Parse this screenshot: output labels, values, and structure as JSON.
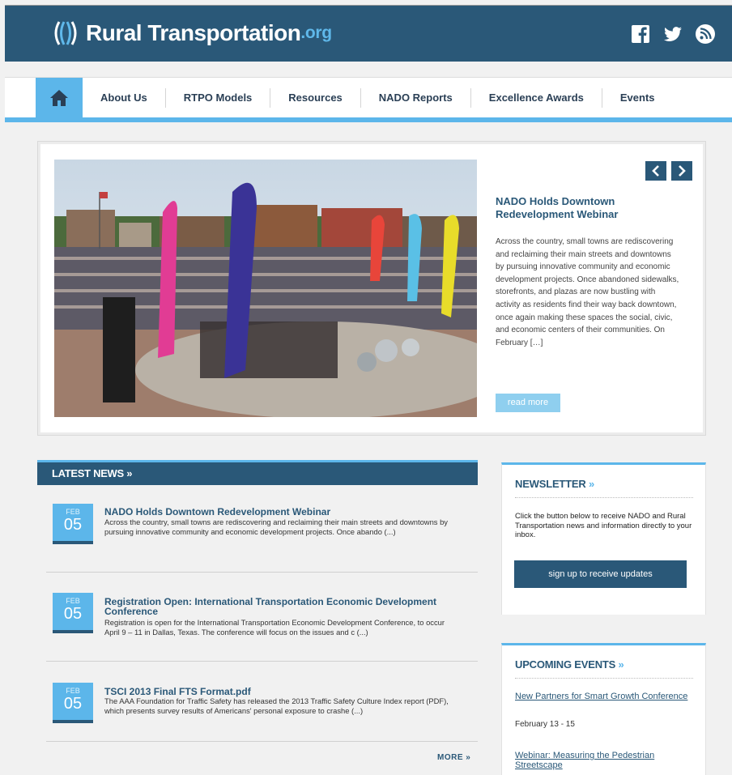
{
  "site": {
    "logo_main": "Rural Transportation",
    "logo_org": ".org"
  },
  "social": {
    "icons": [
      "facebook-icon",
      "twitter-icon",
      "rss-icon"
    ]
  },
  "nav": {
    "home_icon": "home-icon",
    "items": [
      {
        "label": "About Us"
      },
      {
        "label": "RTPO Models"
      },
      {
        "label": "Resources"
      },
      {
        "label": "NADO Reports"
      },
      {
        "label": "Excellence Awards"
      },
      {
        "label": "Events"
      }
    ]
  },
  "slider": {
    "prev_icon": "chevron-left-icon",
    "next_icon": "chevron-right-icon",
    "title": "NADO Holds Downtown Redevelopment Webinar",
    "text": "Across the country, small towns are rediscovering and reclaiming their main streets and downtowns by pursuing innovative community and economic development projects.  Once abandoned sidewalks, storefronts, and plazas are now bustling with activity as residents find their way back downtown, once again making these spaces the social, civic, and economic centers of their communities. On February […]",
    "read_more": "read more"
  },
  "latest_news": {
    "heading": "LATEST NEWS",
    "heading_arrow": "»",
    "items": [
      {
        "month": "FEB",
        "day": "05",
        "title": "NADO Holds Downtown Redevelopment Webinar",
        "text": "Across the country, small towns are rediscovering and reclaiming their main streets and downtowns by pursuing innovative community and economic development projects.  Once abando (...)"
      },
      {
        "month": "FEB",
        "day": "05",
        "title": "Registration Open: International Transportation Economic Development Conference",
        "text": "Registration is open for the International Transportation Economic Development Conference, to occur April 9 – 11 in Dallas, Texas.  The conference will focus on the issues and c (...)"
      },
      {
        "month": "FEB",
        "day": "05",
        "title": "TSCI 2013 Final FTS Format.pdf",
        "text": "The AAA Foundation for Traffic Safety has released the 2013 Traffic Safety Culture Index report (PDF), which presents survey results of Americans' personal exposure to crashe (...)"
      }
    ],
    "more": "MORE",
    "more_arrow": "»"
  },
  "newsletter": {
    "heading": "NEWSLETTER",
    "heading_arrow": "»",
    "text": "Click the button below to receive NADO and Rural Transportation news and information directly to your inbox.",
    "button": "sign up to receive updates"
  },
  "events": {
    "heading": "UPCOMING EVENTS",
    "heading_arrow": "»",
    "items": [
      {
        "title": "New Partners for Smart Growth Conference",
        "date": "February 13 - 15"
      },
      {
        "title": "Webinar: Measuring the Pedestrian Streetscape",
        "date": ""
      }
    ]
  },
  "colors": {
    "header_bg": "#2a5878",
    "accent_blue": "#5cb6ea",
    "read_more_bg": "#8fcfef",
    "page_bg": "#f1f1f1"
  }
}
